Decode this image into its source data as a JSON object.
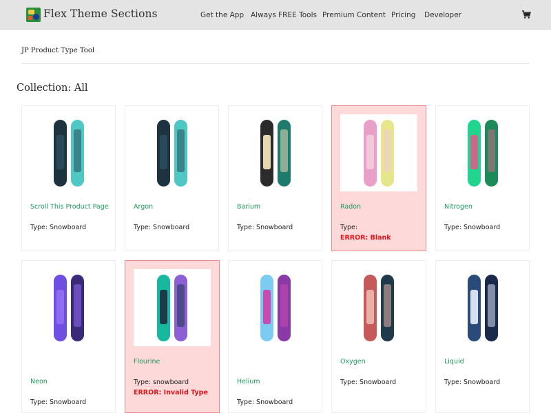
{
  "header": {
    "site_title": "Flex Theme Sections",
    "nav": [
      "Get the App",
      "Always FREE Tools",
      "Premium Content",
      "Pricing",
      "Developer"
    ],
    "cart_icon": "cart-icon"
  },
  "page": {
    "subtitle": "JP Product Type Tool",
    "collection_title": "Collection: All"
  },
  "colors": {
    "link_green": "#1f9a5c",
    "error_red": "#e0151c",
    "error_bg": "#fdd9d9"
  },
  "products": [
    {
      "name": "Scroll This Product Page",
      "type_text": "Type: Snowboard",
      "error": "",
      "colors": [
        "#1d3440",
        "#4fc7c4",
        "#2a4a5a"
      ]
    },
    {
      "name": "Argon",
      "type_text": "Type: Snowboard",
      "error": "",
      "colors": [
        "#1d3440",
        "#4fc7c4",
        "#2a4a5a"
      ]
    },
    {
      "name": "Barium",
      "type_text": "Type: Snowboard",
      "error": "",
      "colors": [
        "#2b2b2b",
        "#1f7a6e",
        "#e6d8b0"
      ]
    },
    {
      "name": "Radon",
      "type_text": "Type:",
      "error": "ERROR: Blank",
      "colors": [
        "#e8a0c8",
        "#e6e68a",
        "#f1c9d8"
      ]
    },
    {
      "name": "Nitrogen",
      "type_text": "Type: Snowboard",
      "error": "",
      "colors": [
        "#22d58e",
        "#1d8a5a",
        "#c96a8a"
      ]
    },
    {
      "name": "Neon",
      "type_text": "Type: Snowboard",
      "error": "",
      "colors": [
        "#6f4fe0",
        "#3b2a7a",
        "#8f6bf2"
      ]
    },
    {
      "name": "Flourine",
      "type_text": "Type: snowboard",
      "error": "ERROR: Invalid Type",
      "colors": [
        "#17b7a0",
        "#8b5fd6",
        "#1c3a4a"
      ]
    },
    {
      "name": "Helium",
      "type_text": "Type: Snowboard",
      "error": "",
      "colors": [
        "#7ccbf0",
        "#8a3aa6",
        "#c94ab0"
      ]
    },
    {
      "name": "Oxygen",
      "type_text": "Type: Snowboard",
      "error": "",
      "colors": [
        "#c45a5a",
        "#1f3a4a",
        "#e8b0a8"
      ]
    },
    {
      "name": "Liquid",
      "type_text": "Type: Snowboard",
      "error": "",
      "colors": [
        "#2a4a7a",
        "#1a2a4a",
        "#d8e0f0"
      ]
    }
  ]
}
